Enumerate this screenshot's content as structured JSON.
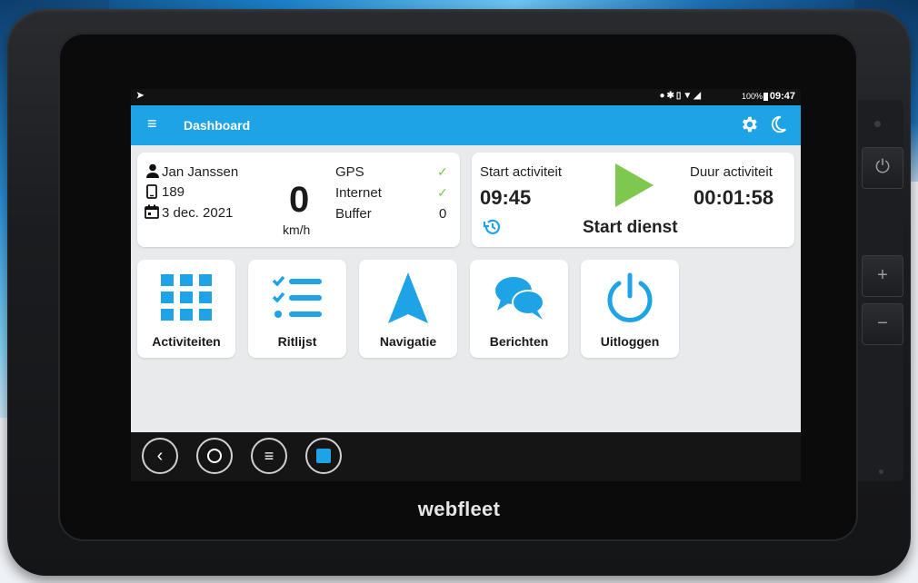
{
  "brand": "webfleet",
  "statusbar": {
    "left_icon": "navigation-notification-icon",
    "icons": "location bluetooth vibrate wifi signal",
    "battery": "100%",
    "time": "09:47"
  },
  "appbar": {
    "title": "Dashboard",
    "menu_icon": "menu-icon",
    "settings_icon": "gear-icon",
    "nightmode_icon": "moon-icon"
  },
  "driver": {
    "name": "Jan Janssen",
    "phone": "189",
    "date": "3 dec. 2021"
  },
  "speed": {
    "value": "0",
    "unit": "km/h"
  },
  "connectivity": [
    {
      "label": "GPS",
      "value": "✓"
    },
    {
      "label": "Internet",
      "value": "✓"
    },
    {
      "label": "Buffer",
      "value": "0"
    }
  ],
  "activity": {
    "start_label": "Start activiteit",
    "start_time": "09:45",
    "duration_label": "Duur activiteit",
    "duration": "00:01:58",
    "action": "Start dienst",
    "history_icon": "history-icon",
    "play_icon": "play-icon"
  },
  "tiles": [
    {
      "label": "Activiteiten",
      "icon": "grid-icon"
    },
    {
      "label": "Ritlijst",
      "icon": "checklist-icon"
    },
    {
      "label": "Navigatie",
      "icon": "navigation-arrow-icon"
    },
    {
      "label": "Berichten",
      "icon": "chat-icon"
    },
    {
      "label": "Uitloggen",
      "icon": "power-icon"
    }
  ],
  "navbar": [
    "back-icon",
    "home-icon",
    "menu-icon",
    "app-icon"
  ],
  "colors": {
    "accent": "#1ea4e6",
    "play_green": "#7ec850",
    "check_green": "#7ec850",
    "screen_bg": "#e9eaec"
  }
}
